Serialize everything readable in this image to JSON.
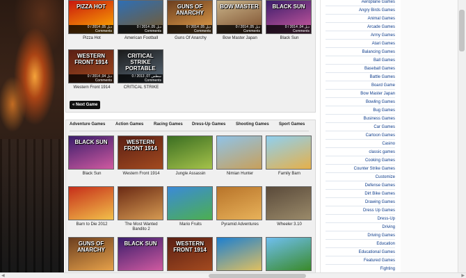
{
  "top_games": [
    {
      "title": "Pizza Hot",
      "art_text": "PIZZA HOT",
      "date": "0 / 2014 ,05 دبل",
      "comments": "Comments",
      "colors": [
        "#c9170f",
        "#ffb300"
      ]
    },
    {
      "title": "American Football",
      "art_text": "",
      "date": "0 / 2014 ,05 دبل",
      "comments": "Comments",
      "colors": [
        "#2e6fb5",
        "#7a5a2a"
      ]
    },
    {
      "title": "Guns Of Anarchy",
      "art_text": "GUNS OF ANARCHY",
      "date": "0 / 2014 ,05 دبل",
      "comments": "Comments",
      "colors": [
        "#6b3e1f",
        "#e6a14a"
      ]
    },
    {
      "title": "Bow Master Japan",
      "art_text": "BOW MASTER",
      "date": "0 / 2014 ,05 دبل",
      "comments": "Comments",
      "colors": [
        "#c9b48a",
        "#7a4b2a"
      ]
    },
    {
      "title": "Black Sun",
      "art_text": "BLACK SUN",
      "date": "0 / 2014 ,04 دبل",
      "comments": "Comments",
      "colors": [
        "#3a1d6b",
        "#d05aa0"
      ]
    },
    {
      "title": "Western Front 1914",
      "art_text": "WESTERN FRONT 1914",
      "date": "0 / 2014 ,04 دبل",
      "comments": "Comments",
      "colors": [
        "#5a1f14",
        "#a34a1f"
      ]
    },
    {
      "title": "CRITICAL STRIKE",
      "art_text": "CRITICAL STRIKE PORTABLE",
      "date": "0 / 2013 ,07 سطس",
      "comments": "Comments",
      "colors": [
        "#1a1a1a",
        "#5b6b7a"
      ]
    }
  ],
  "next_button": "« Next Game",
  "category_tabs": [
    "Adventure Games",
    "Action Games",
    "Racing Games",
    "Dress-Up Games",
    "Shooting Games",
    "Sport Games"
  ],
  "category_games": [
    {
      "title": "Black Sun",
      "art_text": "BLACK SUN",
      "colors": [
        "#3a1d6b",
        "#d05aa0"
      ]
    },
    {
      "title": "Western Front 1914",
      "art_text": "WESTERN FRONT 1914",
      "colors": [
        "#5a1f14",
        "#a34a1f"
      ]
    },
    {
      "title": "Jungle Assassin",
      "art_text": "",
      "colors": [
        "#3b6e22",
        "#a5c24a"
      ]
    },
    {
      "title": "Nimian Hunter",
      "art_text": "",
      "colors": [
        "#8fc3e8",
        "#c8a05a"
      ]
    },
    {
      "title": "Family Barn",
      "art_text": "",
      "colors": [
        "#8fd0f0",
        "#e5b04a"
      ]
    },
    {
      "title": "Barn to Die 2012",
      "art_text": "",
      "colors": [
        "#c62e1a",
        "#f2c04a"
      ]
    },
    {
      "title": "The Most Wanted Bandito 2",
      "art_text": "",
      "colors": [
        "#6b2a14",
        "#d59a52"
      ]
    },
    {
      "title": "Mario Fruits",
      "art_text": "",
      "colors": [
        "#3b8ad8",
        "#4caf50"
      ]
    },
    {
      "title": "Pyramid Adventures",
      "art_text": "",
      "colors": [
        "#b8742a",
        "#e8b25a"
      ]
    },
    {
      "title": "Wheeler 3.10",
      "art_text": "",
      "colors": [
        "#5a4a3a",
        "#9a8a6a"
      ]
    },
    {
      "title": "",
      "art_text": "GUNS OF ANARCHY",
      "colors": [
        "#6b3e1f",
        "#e6a14a"
      ]
    },
    {
      "title": "",
      "art_text": "BLACK SUN",
      "colors": [
        "#3a1d6b",
        "#d05aa0"
      ]
    },
    {
      "title": "",
      "art_text": "WESTERN FRONT 1914",
      "colors": [
        "#5a1f14",
        "#a34a1f"
      ]
    },
    {
      "title": "",
      "art_text": "",
      "colors": [
        "#1d7fd0",
        "#e0c060"
      ]
    },
    {
      "title": "",
      "art_text": "",
      "colors": [
        "#6fbff0",
        "#3a8a2a"
      ]
    }
  ],
  "sidebar_categories": [
    "Aeroplane Games",
    "Angry Birds Games",
    "Animal Games",
    "Arcade Games",
    "Army Games",
    "Atari Games",
    "Balancing Games",
    "Ball Games",
    "Baseball Games",
    "Battle Games",
    "Board Game",
    "Bow Master Japan",
    "Bowling Games",
    "Bug Games",
    "Business Games",
    "Car Games",
    "Cartoon Games",
    "Casino",
    "classic games",
    "Cooking Games",
    "Counter Strike Games",
    "Customize",
    "Defense Games",
    "Dirt Bike Games",
    "Drawing Games",
    "Dress Up Games",
    "Dress-Up",
    "Driving",
    "Driving Games",
    "Education",
    "Educational Games",
    "Featured Games",
    "Fighting"
  ]
}
